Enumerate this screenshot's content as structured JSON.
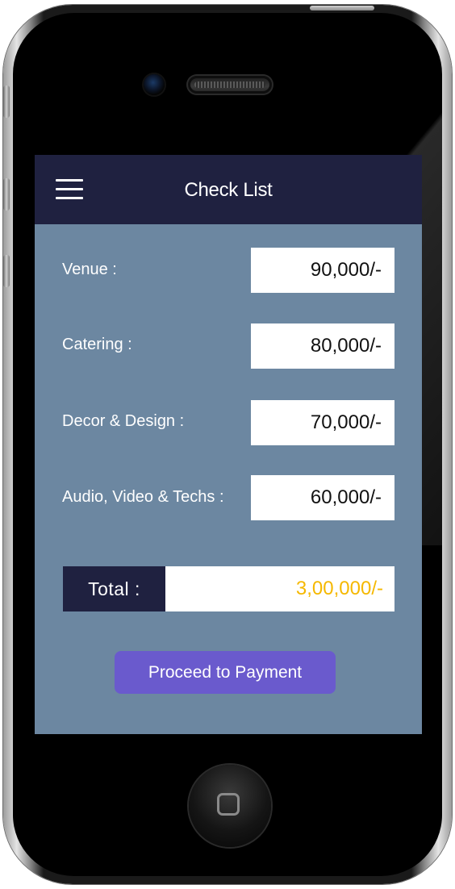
{
  "header": {
    "title": "Check List",
    "menu_icon": "hamburger-menu-icon"
  },
  "items": [
    {
      "label": "Venue :",
      "amount": "90,000/-"
    },
    {
      "label": "Catering :",
      "amount": "80,000/-"
    },
    {
      "label": "Decor & Design :",
      "amount": "70,000/-"
    },
    {
      "label": "Audio, Video & Techs :",
      "amount": "60,000/-"
    }
  ],
  "total": {
    "label": "Total :",
    "value": "3,00,000/-"
  },
  "actions": {
    "proceed_label": "Proceed to Payment"
  },
  "colors": {
    "header_bg": "#1f2140",
    "screen_bg": "#6c87a1",
    "total_value": "#f5b800",
    "button_bg": "#6a5acd"
  }
}
